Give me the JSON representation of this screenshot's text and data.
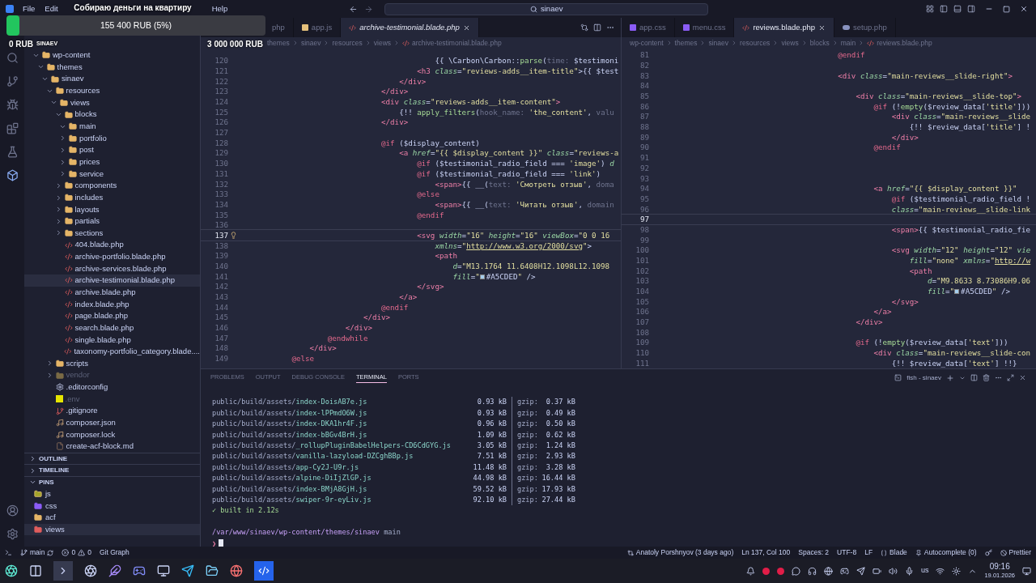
{
  "overlay": {
    "title": "Собираю деньги на квартиру",
    "progress": {
      "label": "155 400 RUB (5%)",
      "level": 0.05
    },
    "min": "0 RUB",
    "author": "SINAEV",
    "max": "3 000 000 RUB"
  },
  "title_bar": {
    "menu": [
      "File",
      "Edit",
      "Help"
    ],
    "search": "sinaev"
  },
  "sidebar": {
    "tree": [
      {
        "label": "wp-content",
        "kind": "folder",
        "expanded": true,
        "selected": false,
        "ignored": false,
        "children": [
          {
            "label": "themes",
            "kind": "folder",
            "expanded": true,
            "selected": false,
            "ignored": false,
            "children": [
              {
                "label": "sinaev",
                "kind": "folder",
                "expanded": true,
                "selected": false,
                "ignored": false,
                "children": [
                  {
                    "label": "resources",
                    "kind": "folder",
                    "expanded": true,
                    "selected": false,
                    "ignored": false,
                    "children": [
                      {
                        "label": "views",
                        "kind": "folder",
                        "expanded": true,
                        "selected": false,
                        "ignored": false,
                        "children": [
                          {
                            "label": "blocks",
                            "kind": "folder",
                            "expanded": true,
                            "selected": false,
                            "ignored": false,
                            "children": [
                              {
                                "label": "main",
                                "kind": "folder",
                                "expanded": true,
                                "selected": false,
                                "ignored": false
                              },
                              {
                                "label": "portfolio",
                                "kind": "folder",
                                "expanded": false,
                                "selected": false,
                                "ignored": false
                              },
                              {
                                "label": "post",
                                "kind": "folder",
                                "expanded": false,
                                "selected": false,
                                "ignored": false
                              },
                              {
                                "label": "prices",
                                "kind": "folder",
                                "expanded": false,
                                "selected": false,
                                "ignored": false
                              },
                              {
                                "label": "service",
                                "kind": "folder",
                                "expanded": false,
                                "selected": false,
                                "ignored": false
                              }
                            ]
                          },
                          {
                            "label": "components",
                            "kind": "folder",
                            "expanded": false,
                            "selected": false,
                            "ignored": false
                          },
                          {
                            "label": "includes",
                            "kind": "folder",
                            "expanded": false,
                            "selected": false,
                            "ignored": false
                          },
                          {
                            "label": "layouts",
                            "kind": "folder",
                            "expanded": false,
                            "selected": false,
                            "ignored": false
                          },
                          {
                            "label": "partials",
                            "kind": "folder",
                            "expanded": false,
                            "selected": false,
                            "ignored": false
                          },
                          {
                            "label": "sections",
                            "kind": "folder",
                            "expanded": false,
                            "selected": false,
                            "ignored": false
                          },
                          {
                            "label": "404.blade.php",
                            "kind": "blade",
                            "selected": false,
                            "ignored": false
                          },
                          {
                            "label": "archive-portfolio.blade.php",
                            "kind": "blade",
                            "selected": false,
                            "ignored": false
                          },
                          {
                            "label": "archive-services.blade.php",
                            "kind": "blade",
                            "selected": false,
                            "ignored": false
                          },
                          {
                            "label": "archive-testimonial.blade.php",
                            "kind": "blade",
                            "selected": true,
                            "ignored": false
                          },
                          {
                            "label": "archive.blade.php",
                            "kind": "blade",
                            "selected": false,
                            "ignored": false
                          },
                          {
                            "label": "index.blade.php",
                            "kind": "blade",
                            "selected": false,
                            "ignored": false
                          },
                          {
                            "label": "page.blade.php",
                            "kind": "blade",
                            "selected": false,
                            "ignored": false
                          },
                          {
                            "label": "search.blade.php",
                            "kind": "blade",
                            "selected": false,
                            "ignored": false
                          },
                          {
                            "label": "single.blade.php",
                            "kind": "blade",
                            "selected": false,
                            "ignored": false
                          },
                          {
                            "label": "taxonomy-portfolio_category.blade....",
                            "kind": "blade",
                            "selected": false,
                            "ignored": false
                          }
                        ]
                      }
                    ]
                  },
                  {
                    "label": "scripts",
                    "kind": "folder",
                    "expanded": false,
                    "selected": false,
                    "ignored": false
                  },
                  {
                    "label": "vendor",
                    "kind": "folder",
                    "expanded": false,
                    "selected": false,
                    "ignored": true
                  },
                  {
                    "label": ".editorconfig",
                    "kind": "config",
                    "selected": false,
                    "ignored": false
                  },
                  {
                    "label": ".env",
                    "kind": "env",
                    "selected": false,
                    "ignored": true
                  },
                  {
                    "label": ".gitignore",
                    "kind": "git",
                    "selected": false,
                    "ignored": false
                  },
                  {
                    "label": "composer.json",
                    "kind": "composer",
                    "selected": false,
                    "ignored": false
                  },
                  {
                    "label": "composer.lock",
                    "kind": "composer",
                    "selected": false,
                    "ignored": false
                  },
                  {
                    "label": "create-acf-block.md",
                    "kind": "md",
                    "selected": false,
                    "ignored": false
                  }
                ]
              }
            ]
          }
        ]
      }
    ],
    "sections": [
      {
        "label": "OUTLINE",
        "expanded": false
      },
      {
        "label": "TIMELINE",
        "expanded": false
      },
      {
        "label": "PINS",
        "expanded": true
      }
    ],
    "pins": [
      {
        "label": "js",
        "kind": "js",
        "selected": false
      },
      {
        "label": "css",
        "kind": "css",
        "selected": false
      },
      {
        "label": "acf",
        "kind": "folder",
        "selected": false
      },
      {
        "label": "views",
        "kind": "views",
        "selected": true
      }
    ]
  },
  "editors": [
    {
      "tabs": [
        {
          "label": "php",
          "selected": false,
          "preview": false
        },
        {
          "label": "app.js",
          "kind": "js",
          "selected": false,
          "preview": false
        },
        {
          "label": "archive-testimonial.blade.php",
          "kind": "blade",
          "selected": true,
          "preview": true
        }
      ],
      "breadcrumbs": [
        "themes",
        "sinaev",
        "resources",
        "views",
        "archive-testimonial.blade.php"
      ],
      "lightbulb": true,
      "lines": [
        {
          "n": "120",
          "current": false,
          "code": [
            {
              "kind": "p",
              "text": "                                            {{ \\Carbon\\Carbon::"
            },
            {
              "kind": "f",
              "text": "parse"
            },
            {
              "kind": "p",
              "text": "("
            },
            {
              "kind": "m",
              "text": "time: "
            },
            {
              "kind": "p",
              "text": "$testimoni"
            }
          ]
        },
        {
          "n": "121",
          "current": false,
          "code": [
            {
              "kind": "t",
              "text": "                                        <h3 "
            },
            {
              "kind": "a",
              "text": "class"
            },
            {
              "kind": "p",
              "text": "="
            },
            {
              "kind": "s",
              "text": "\"reviews-adds__item-title\""
            },
            {
              "kind": "p",
              "text": ">{{ $test"
            }
          ]
        },
        {
          "n": "122",
          "current": false,
          "code": [
            {
              "kind": "t",
              "text": "                                    </div>"
            }
          ]
        },
        {
          "n": "123",
          "current": false,
          "code": [
            {
              "kind": "t",
              "text": "                                </div>"
            }
          ]
        },
        {
          "n": "124",
          "current": false,
          "code": [
            {
              "kind": "t",
              "text": "                                <div "
            },
            {
              "kind": "a",
              "text": "class"
            },
            {
              "kind": "p",
              "text": "="
            },
            {
              "kind": "s",
              "text": "\"reviews-adds__item-content\""
            },
            {
              "kind": "t",
              "text": ">"
            }
          ]
        },
        {
          "n": "125",
          "current": false,
          "code": [
            {
              "kind": "p",
              "text": "                                    {!! "
            },
            {
              "kind": "f",
              "text": "apply_filters"
            },
            {
              "kind": "p",
              "text": "("
            },
            {
              "kind": "m",
              "text": "hook_name: "
            },
            {
              "kind": "s",
              "text": "'the_content'"
            },
            {
              "kind": "p",
              "text": ", "
            },
            {
              "kind": "m",
              "text": "valu"
            }
          ]
        },
        {
          "n": "126",
          "current": false,
          "code": [
            {
              "kind": "t",
              "text": "                                </div>"
            }
          ]
        },
        {
          "n": "127",
          "current": false
        },
        {
          "n": "128",
          "current": false,
          "code": [
            {
              "kind": "d",
              "text": "                                @if"
            },
            {
              "kind": "p",
              "text": " ($display_content)"
            }
          ]
        },
        {
          "n": "129",
          "current": false,
          "code": [
            {
              "kind": "t",
              "text": "                                    <a "
            },
            {
              "kind": "a",
              "text": "href"
            },
            {
              "kind": "p",
              "text": "="
            },
            {
              "kind": "s",
              "text": "\"{{ $display_content }}\" "
            },
            {
              "kind": "a",
              "text": "class"
            },
            {
              "kind": "p",
              "text": "="
            },
            {
              "kind": "s",
              "text": "\"reviews-a"
            }
          ]
        },
        {
          "n": "130",
          "current": false,
          "code": [
            {
              "kind": "d",
              "text": "                                        @if"
            },
            {
              "kind": "p",
              "text": " ($testimonial_radio_field === "
            },
            {
              "kind": "s",
              "text": "'image'"
            },
            {
              "kind": "p",
              "text": ") "
            },
            {
              "kind": "a",
              "text": "d"
            }
          ]
        },
        {
          "n": "131",
          "current": false,
          "code": [
            {
              "kind": "d",
              "text": "                                        @if"
            },
            {
              "kind": "p",
              "text": " ($testimonial_radio_field === "
            },
            {
              "kind": "s",
              "text": "'link'"
            },
            {
              "kind": "p",
              "text": ")"
            }
          ]
        },
        {
          "n": "132",
          "current": false,
          "code": [
            {
              "kind": "t",
              "text": "                                            <span>"
            },
            {
              "kind": "p",
              "text": "{{ __("
            },
            {
              "kind": "m",
              "text": "text: "
            },
            {
              "kind": "s",
              "text": "'Смотреть отзыв'"
            },
            {
              "kind": "p",
              "text": ", "
            },
            {
              "kind": "m",
              "text": "doma"
            }
          ]
        },
        {
          "n": "133",
          "current": false,
          "code": [
            {
              "kind": "d",
              "text": "                                        @else"
            }
          ]
        },
        {
          "n": "134",
          "current": false,
          "code": [
            {
              "kind": "t",
              "text": "                                            <span>"
            },
            {
              "kind": "p",
              "text": "{{ __("
            },
            {
              "kind": "m",
              "text": "text: "
            },
            {
              "kind": "s",
              "text": "'Читать отзыв'"
            },
            {
              "kind": "p",
              "text": ", "
            },
            {
              "kind": "m",
              "text": "domain"
            }
          ]
        },
        {
          "n": "135",
          "current": false,
          "code": [
            {
              "kind": "d",
              "text": "                                        @endif"
            }
          ]
        },
        {
          "n": "136",
          "current": false
        },
        {
          "n": "137",
          "current": true,
          "code": [
            {
              "kind": "t",
              "text": "                                        <svg "
            },
            {
              "kind": "a",
              "text": "width"
            },
            {
              "kind": "p",
              "text": "="
            },
            {
              "kind": "s",
              "text": "\"16\" "
            },
            {
              "kind": "a",
              "text": "height"
            },
            {
              "kind": "p",
              "text": "="
            },
            {
              "kind": "s",
              "text": "\"16\" "
            },
            {
              "kind": "a",
              "text": "viewBox"
            },
            {
              "kind": "p",
              "text": "="
            },
            {
              "kind": "s",
              "text": "\"0 0 16"
            }
          ]
        },
        {
          "n": "138",
          "current": false,
          "code": [
            {
              "kind": "a",
              "text": "                                            xmlns"
            },
            {
              "kind": "p",
              "text": "="
            },
            {
              "kind": "s",
              "text": "\""
            },
            {
              "kind": "u",
              "text": "http://www.w3.org/2000/svg"
            },
            {
              "kind": "s",
              "text": "\""
            },
            {
              "kind": "p",
              "text": ">"
            }
          ]
        },
        {
          "n": "139",
          "current": false,
          "code": [
            {
              "kind": "t",
              "text": "                                            <path"
            }
          ]
        },
        {
          "n": "140",
          "current": false,
          "code": [
            {
              "kind": "a",
              "text": "                                                d"
            },
            {
              "kind": "p",
              "text": "="
            },
            {
              "kind": "s",
              "text": "\"M13.1764 11.6408H12.1098L12.1098"
            }
          ]
        },
        {
          "n": "141",
          "current": false,
          "code": [
            {
              "kind": "a",
              "text": "                                                fill"
            },
            {
              "kind": "p",
              "text": "="
            },
            {
              "kind": "s",
              "text": "\""
            },
            {
              "kind": "c",
              "text": "#A5CDED"
            },
            {
              "kind": "s",
              "text": "\""
            },
            {
              "kind": "p",
              "text": " />"
            }
          ]
        },
        {
          "n": "142",
          "current": false,
          "code": [
            {
              "kind": "t",
              "text": "                                        </svg>"
            }
          ]
        },
        {
          "n": "143",
          "current": false,
          "code": [
            {
              "kind": "t",
              "text": "                                    </a>"
            }
          ]
        },
        {
          "n": "144",
          "current": false,
          "code": [
            {
              "kind": "d",
              "text": "                                @endif"
            }
          ]
        },
        {
          "n": "145",
          "current": false,
          "code": [
            {
              "kind": "t",
              "text": "                            </div>"
            }
          ]
        },
        {
          "n": "146",
          "current": false,
          "code": [
            {
              "kind": "t",
              "text": "                        </div>"
            }
          ]
        },
        {
          "n": "147",
          "current": false,
          "code": [
            {
              "kind": "d",
              "text": "                    @endwhile"
            }
          ]
        },
        {
          "n": "148",
          "current": false,
          "code": [
            {
              "kind": "t",
              "text": "                </div>"
            }
          ]
        },
        {
          "n": "149",
          "current": false,
          "code": [
            {
              "kind": "d",
              "text": "            @else"
            }
          ]
        }
      ]
    },
    {
      "tabs": [
        {
          "label": "app.css",
          "kind": "css",
          "selected": false,
          "preview": false
        },
        {
          "label": "menu.css",
          "kind": "css",
          "selected": false,
          "preview": false
        },
        {
          "label": "reviews.blade.php",
          "kind": "blade",
          "selected": true,
          "preview": false
        },
        {
          "label": "setup.php",
          "kind": "php",
          "selected": false,
          "preview": false
        }
      ],
      "breadcrumbs": [
        "wp-content",
        "themes",
        "sinaev",
        "resources",
        "views",
        "blocks",
        "main",
        "reviews.blade.php"
      ],
      "lightbulb": false,
      "lines": [
        {
          "n": "81",
          "current": false,
          "code": [
            {
              "kind": "d",
              "text": "                                        @endif"
            }
          ]
        },
        {
          "n": "82",
          "current": false
        },
        {
          "n": "83",
          "current": false,
          "code": [
            {
              "kind": "t",
              "text": "                                        <div "
            },
            {
              "kind": "a",
              "text": "class"
            },
            {
              "kind": "p",
              "text": "="
            },
            {
              "kind": "s",
              "text": "\"main-reviews__slide-right\""
            },
            {
              "kind": "t",
              "text": ">"
            }
          ]
        },
        {
          "n": "84",
          "current": false
        },
        {
          "n": "85",
          "current": false,
          "code": [
            {
              "kind": "t",
              "text": "                                            <div "
            },
            {
              "kind": "a",
              "text": "class"
            },
            {
              "kind": "p",
              "text": "="
            },
            {
              "kind": "s",
              "text": "\"main-reviews__slide-top\""
            },
            {
              "kind": "t",
              "text": ">"
            }
          ]
        },
        {
          "n": "86",
          "current": false,
          "code": [
            {
              "kind": "d",
              "text": "                                                @if"
            },
            {
              "kind": "p",
              "text": " (!"
            },
            {
              "kind": "f",
              "text": "empty"
            },
            {
              "kind": "p",
              "text": "($review_data["
            },
            {
              "kind": "s",
              "text": "'title'"
            },
            {
              "kind": "p",
              "text": "]))"
            }
          ]
        },
        {
          "n": "87",
          "current": false,
          "code": [
            {
              "kind": "t",
              "text": "                                                    <div "
            },
            {
              "kind": "a",
              "text": "class"
            },
            {
              "kind": "p",
              "text": "="
            },
            {
              "kind": "s",
              "text": "\"main-reviews__slide"
            }
          ]
        },
        {
          "n": "88",
          "current": false,
          "code": [
            {
              "kind": "p",
              "text": "                                                        {!! $review_data["
            },
            {
              "kind": "s",
              "text": "'title'"
            },
            {
              "kind": "p",
              "text": "] !"
            }
          ]
        },
        {
          "n": "89",
          "current": false,
          "code": [
            {
              "kind": "t",
              "text": "                                                    </div>"
            }
          ]
        },
        {
          "n": "90",
          "current": false,
          "code": [
            {
              "kind": "d",
              "text": "                                                @endif"
            }
          ]
        },
        {
          "n": "91",
          "current": false
        },
        {
          "n": "92",
          "current": false
        },
        {
          "n": "93",
          "current": false
        },
        {
          "n": "94",
          "current": false,
          "code": [
            {
              "kind": "t",
              "text": "                                                <a "
            },
            {
              "kind": "a",
              "text": "href"
            },
            {
              "kind": "p",
              "text": "="
            },
            {
              "kind": "s",
              "text": "\"{{ $display_content }}\""
            }
          ]
        },
        {
          "n": "95",
          "current": false,
          "code": [
            {
              "kind": "d",
              "text": "                                                    @if"
            },
            {
              "kind": "p",
              "text": " ($testimonial_radio_field !"
            }
          ]
        },
        {
          "n": "96",
          "current": false,
          "code": [
            {
              "kind": "a",
              "text": "                                                    class"
            },
            {
              "kind": "p",
              "text": "="
            },
            {
              "kind": "s",
              "text": "\"main-reviews__slide-link"
            }
          ]
        },
        {
          "n": "97",
          "current": true
        },
        {
          "n": "98",
          "current": false,
          "code": [
            {
              "kind": "t",
              "text": "                                                    <span>"
            },
            {
              "kind": "p",
              "text": "{{ $testimonial_radio_fie"
            }
          ]
        },
        {
          "n": "99",
          "current": false
        },
        {
          "n": "100",
          "current": false,
          "code": [
            {
              "kind": "t",
              "text": "                                                    <svg "
            },
            {
              "kind": "a",
              "text": "width"
            },
            {
              "kind": "p",
              "text": "="
            },
            {
              "kind": "s",
              "text": "\"12\" "
            },
            {
              "kind": "a",
              "text": "height"
            },
            {
              "kind": "p",
              "text": "="
            },
            {
              "kind": "s",
              "text": "\"12\" "
            },
            {
              "kind": "a",
              "text": "vie"
            }
          ]
        },
        {
          "n": "101",
          "current": false,
          "code": [
            {
              "kind": "a",
              "text": "                                                        fill"
            },
            {
              "kind": "p",
              "text": "="
            },
            {
              "kind": "s",
              "text": "\"none\" "
            },
            {
              "kind": "a",
              "text": "xmlns"
            },
            {
              "kind": "p",
              "text": "="
            },
            {
              "kind": "s",
              "text": "\""
            },
            {
              "kind": "u",
              "text": "http://w"
            }
          ]
        },
        {
          "n": "102",
          "current": false,
          "code": [
            {
              "kind": "t",
              "text": "                                                        <path"
            }
          ]
        },
        {
          "n": "103",
          "current": false,
          "code": [
            {
              "kind": "a",
              "text": "                                                            d"
            },
            {
              "kind": "p",
              "text": "="
            },
            {
              "kind": "s",
              "text": "\"M9.8633 8.73086H9.06"
            }
          ]
        },
        {
          "n": "104",
          "current": false,
          "code": [
            {
              "kind": "a",
              "text": "                                                            fill"
            },
            {
              "kind": "p",
              "text": "="
            },
            {
              "kind": "s",
              "text": "\""
            },
            {
              "kind": "c",
              "text": "#A5CDED"
            },
            {
              "kind": "s",
              "text": "\""
            },
            {
              "kind": "p",
              "text": " />"
            }
          ]
        },
        {
          "n": "105",
          "current": false,
          "code": [
            {
              "kind": "t",
              "text": "                                                    </svg>"
            }
          ]
        },
        {
          "n": "106",
          "current": false,
          "code": [
            {
              "kind": "t",
              "text": "                                                </a>"
            }
          ]
        },
        {
          "n": "107",
          "current": false,
          "code": [
            {
              "kind": "t",
              "text": "                                            </div>"
            }
          ]
        },
        {
          "n": "108",
          "current": false
        },
        {
          "n": "109",
          "current": false,
          "code": [
            {
              "kind": "d",
              "text": "                                            @if"
            },
            {
              "kind": "p",
              "text": " (!"
            },
            {
              "kind": "f",
              "text": "empty"
            },
            {
              "kind": "p",
              "text": "($review_data["
            },
            {
              "kind": "s",
              "text": "'text'"
            },
            {
              "kind": "p",
              "text": "]))"
            }
          ]
        },
        {
          "n": "110",
          "current": false,
          "code": [
            {
              "kind": "t",
              "text": "                                                <div "
            },
            {
              "kind": "a",
              "text": "class"
            },
            {
              "kind": "p",
              "text": "="
            },
            {
              "kind": "s",
              "text": "\"main-reviews__slide-con"
            }
          ]
        },
        {
          "n": "111",
          "current": false,
          "code": [
            {
              "kind": "p",
              "text": "                                                    {!! $review_data["
            },
            {
              "kind": "s",
              "text": "'text'"
            },
            {
              "kind": "p",
              "text": "] !!}"
            }
          ]
        }
      ]
    }
  ],
  "panel": {
    "tabs": [
      {
        "label": "PROBLEMS",
        "selected": false
      },
      {
        "label": "OUTPUT",
        "selected": false
      },
      {
        "label": "DEBUG CONSOLE",
        "selected": false
      },
      {
        "label": "TERMINAL",
        "selected": true
      },
      {
        "label": "PORTS",
        "selected": false
      }
    ],
    "shell": "fish - sinaev"
  },
  "terminal": {
    "files": [
      {
        "dir": "public/build/assets/",
        "file": "index-DoisAB7e.js",
        "size": "0.93 kB",
        "gzip_label": "gzip:",
        "gzip": "0.37 kB"
      },
      {
        "dir": "public/build/assets/",
        "file": "index-lPPmdO6W.js",
        "size": "0.93 kB",
        "gzip_label": "gzip:",
        "gzip": "0.49 kB"
      },
      {
        "dir": "public/build/assets/",
        "file": "index-DKA1hr4F.js",
        "size": "0.96 kB",
        "gzip_label": "gzip:",
        "gzip": "0.50 kB"
      },
      {
        "dir": "public/build/assets/",
        "file": "index-bBGv4BrH.js",
        "size": "1.09 kB",
        "gzip_label": "gzip:",
        "gzip": "0.62 kB"
      },
      {
        "dir": "public/build/assets/",
        "file": "_rollupPluginBabelHelpers-CD6CdGYG.js",
        "size": "3.05 kB",
        "gzip_label": "gzip:",
        "gzip": "1.24 kB"
      },
      {
        "dir": "public/build/assets/",
        "file": "vanilla-lazyload-DZCghBBp.js",
        "size": "7.51 kB",
        "gzip_label": "gzip:",
        "gzip": "2.93 kB"
      },
      {
        "dir": "public/build/assets/",
        "file": "app-Cy2J-U9r.js",
        "size": "11.48 kB",
        "gzip_label": "gzip:",
        "gzip": "3.28 kB"
      },
      {
        "dir": "public/build/assets/",
        "file": "alpine-DiIjZlGP.js",
        "size": "44.98 kB",
        "gzip_label": "gzip:",
        "gzip": "16.44 kB"
      },
      {
        "dir": "public/build/assets/",
        "file": "index-BMjA8GjH.js",
        "size": "59.52 kB",
        "gzip_label": "gzip:",
        "gzip": "17.93 kB"
      },
      {
        "dir": "public/build/assets/",
        "file": "swiper-9r-eyLiv.js",
        "size": "92.10 kB",
        "gzip_label": "gzip:",
        "gzip": "27.44 kB"
      }
    ],
    "built": "✓ built in 2.12s",
    "cwd": "/var/www/sinaev/wp-content/themes/sinaev",
    "branch": "main",
    "prompt": "❯"
  },
  "status_bar": {
    "branch": "main",
    "errors": "0",
    "warnings": "0",
    "git_graph": "Git Graph",
    "right": [
      {
        "kind": "blame",
        "text": "Anatoly Porshnyov (3 days ago)"
      },
      {
        "kind": "text",
        "text": "Ln 137, Col 100"
      },
      {
        "kind": "text",
        "text": "Spaces: 2"
      },
      {
        "kind": "text",
        "text": "UTF-8"
      },
      {
        "kind": "text",
        "text": "LF"
      },
      {
        "kind": "language",
        "text": "Blade"
      },
      {
        "kind": "autocomplete",
        "text": "Autocomplete (0)"
      },
      {
        "kind": "key"
      },
      {
        "kind": "prettier",
        "text": "Prettier"
      }
    ]
  },
  "taskbar": {
    "layout": "us",
    "time": "09:16",
    "date": "19.01.2026"
  }
}
